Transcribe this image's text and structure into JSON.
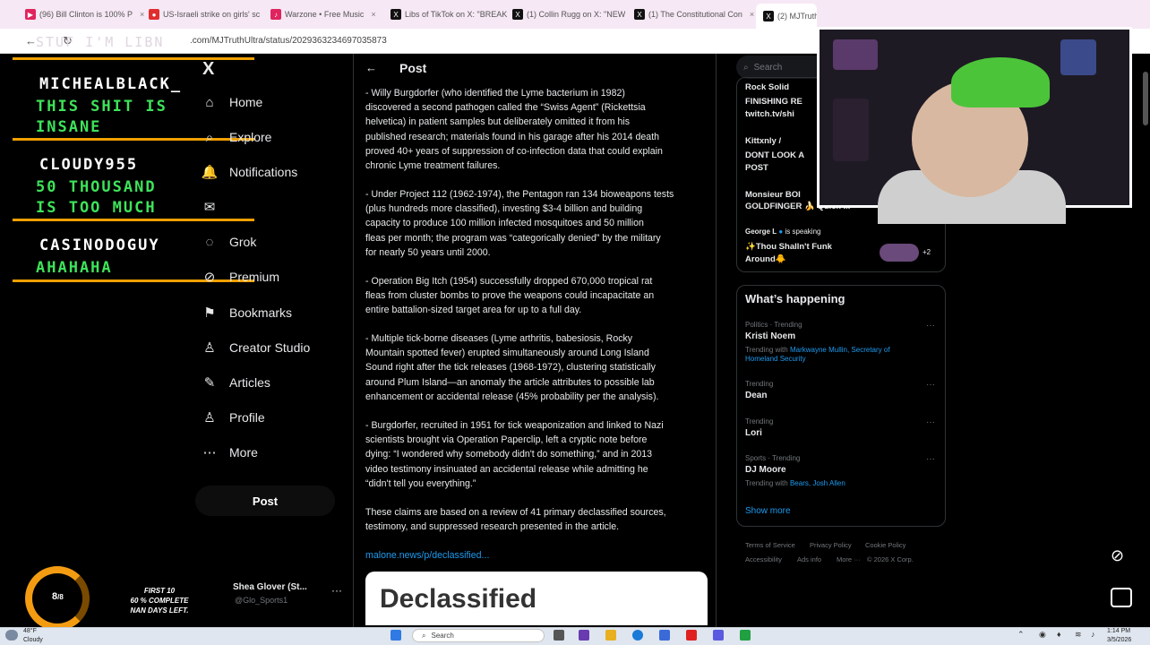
{
  "browser": {
    "tabs": [
      {
        "label": "(96) Bill Clinton is 100% P",
        "color": "#e0245e"
      },
      {
        "label": "US-Israeli strike on girls' sc",
        "color": "#e02d2d"
      },
      {
        "label": "Warzone • Free Music",
        "color": "#e0245e"
      },
      {
        "label": "Libs of TikTok on X: \"BREAK",
        "color": "#111111"
      },
      {
        "label": "(1) Collin Rugg on X: \"NEW",
        "color": "#111111"
      },
      {
        "label": "(1) The Constitutional Con",
        "color": "#111111"
      },
      {
        "label": "(2) MJTruth",
        "color": "#111111"
      }
    ],
    "url": ".com/MJTruthUltra/status/2029363234697035873"
  },
  "overlay": {
    "top_text": "STUF I'M LIBN",
    "chat": [
      {
        "name": "MICHEALBLACK_",
        "message_lines": [
          "THIS SHIT IS",
          "INSANE"
        ]
      },
      {
        "name": "CLOUDY955",
        "message_lines": [
          "50 THOUSAND",
          "IS TOO MUCH"
        ]
      },
      {
        "name": "CASINODOGUY",
        "message_lines": [
          "AHAHAHA"
        ]
      }
    ],
    "goal": {
      "number": "8",
      "number_sub": "/8",
      "text_lines": [
        "FIRST 10",
        "60 % COMPLETE",
        "NAN DAYS LEFT."
      ]
    }
  },
  "nav": {
    "logo": "X",
    "items": [
      {
        "label": "Home",
        "icon": "home-icon",
        "glyph": "⌂"
      },
      {
        "label": "Explore",
        "icon": "search-icon",
        "glyph": "⌕"
      },
      {
        "label": "Notifications",
        "icon": "bell-icon",
        "glyph": "🔔"
      },
      {
        "label": "",
        "icon": "mail-icon",
        "glyph": "✉"
      },
      {
        "label": "Grok",
        "icon": "grok-icon",
        "glyph": "◌"
      },
      {
        "label": "Premium",
        "icon": "premium-icon",
        "glyph": "⊘"
      },
      {
        "label": "Bookmarks",
        "icon": "bookmark-icon",
        "glyph": "⚑"
      },
      {
        "label": "Creator Studio",
        "icon": "creator-studio-icon",
        "glyph": "♙"
      },
      {
        "label": "Articles",
        "icon": "articles-icon",
        "glyph": "✎"
      },
      {
        "label": "Profile",
        "icon": "profile-icon",
        "glyph": "♙"
      },
      {
        "label": "More",
        "icon": "more-icon",
        "glyph": "⋯"
      }
    ],
    "post_button": "Post",
    "account": {
      "name": "Shea Glover (St...",
      "handle": "@Glo_Sports1"
    }
  },
  "post": {
    "header_title": "Post",
    "paragraphs": [
      [
        "- Willy Burgdorfer (who identified the Lyme bacterium in 1982)",
        "discovered a second pathogen called the “Swiss Agent” (Rickettsia",
        "helvetica) in patient samples but deliberately omitted it from his",
        "published research; materials found in his garage after his 2014 death",
        "proved 40+ years of suppression of co-infection data that could explain",
        "chronic Lyme treatment failures."
      ],
      [
        "- Under Project 112 (1962-1974), the Pentagon ran 134 bioweapons tests",
        "(plus hundreds more classified), investing $3-4 billion and building",
        "capacity to produce 100 million infected mosquitoes and 50 million",
        "fleas per month; the program was “categorically denied” by the military",
        "for nearly 50 years until 2000."
      ],
      [
        "- Operation Big Itch (1954) successfully dropped 670,000 tropical rat",
        "fleas from cluster bombs to prove the weapons could incapacitate an",
        "entire battalion-sized target area for up to a full day."
      ],
      [
        "- Multiple tick-borne diseases (Lyme arthritis, babesiosis, Rocky",
        "Mountain spotted fever) erupted simultaneously around Long Island",
        "Sound right after the tick releases (1968-1972), clustering statistically",
        "around Plum Island—an anomaly the article attributes to possible lab",
        "enhancement or accidental release (45% probability per the analysis)."
      ],
      [
        "- Burgdorfer, recruited in 1951 for tick weaponization and linked to Nazi",
        "scientists brought via Operation Paperclip, left a cryptic note before",
        "dying: “I wondered why somebody didn't do something,” and in 2013",
        "video testimony insinuated an accidental release while admitting he",
        "“didn't tell you everything.”"
      ],
      [
        "These claims are based on a review of 41 primary declassified sources,",
        "testimony, and suppressed research presented in the article."
      ]
    ],
    "link": "malone.news/p/declassified...",
    "card_title": "Declassified"
  },
  "right": {
    "search_placeholder": "Search",
    "spaces": [
      {
        "host": "Rock Solid",
        "title": "FINISHING RE",
        "sub": "twitch.tv/shi"
      },
      {
        "host": "Kittxnly /",
        "title": "DONT LOOK A",
        "sub": "POST"
      },
      {
        "host": "",
        "title": "Monsieur BOI",
        "sub": "GOLDFINGER 🍌 Quick ..."
      },
      {
        "host": "George L",
        "title": "✨Thou Shalln't Funk",
        "sub": "Around🐥"
      }
    ],
    "speaking_label": "is speaking",
    "listeners": "+2",
    "happening_title": "What’s happening",
    "trends": [
      {
        "meta": "Politics · Trending",
        "name": "Kristi Noem",
        "with_prefix": "Trending with",
        "with": "Markwayne Mullin, Secretary of Homeland Security"
      },
      {
        "meta": "Trending",
        "name": "Dean",
        "with_prefix": "",
        "with": ""
      },
      {
        "meta": "Trending",
        "name": "Lori",
        "with_prefix": "",
        "with": ""
      },
      {
        "meta": "Sports · Trending",
        "name": "DJ Moore",
        "with_prefix": "Trending with",
        "with": "Bears, Josh Allen"
      }
    ],
    "show_more": "Show more",
    "footer": [
      "Terms of Service",
      "Privacy Policy",
      "Cookie Policy",
      "Accessibility",
      "Ads info",
      "More ···",
      "© 2026 X Corp."
    ]
  },
  "taskbar": {
    "weather_temp": "48°F",
    "weather_cond": "Cloudy",
    "search_label": "Search",
    "time": "1:14 PM",
    "date": "3/5/2026"
  },
  "colors": {
    "accent": "#1d9bf0",
    "chat_green": "#3ee35a",
    "chat_bar": "#f0a000"
  }
}
